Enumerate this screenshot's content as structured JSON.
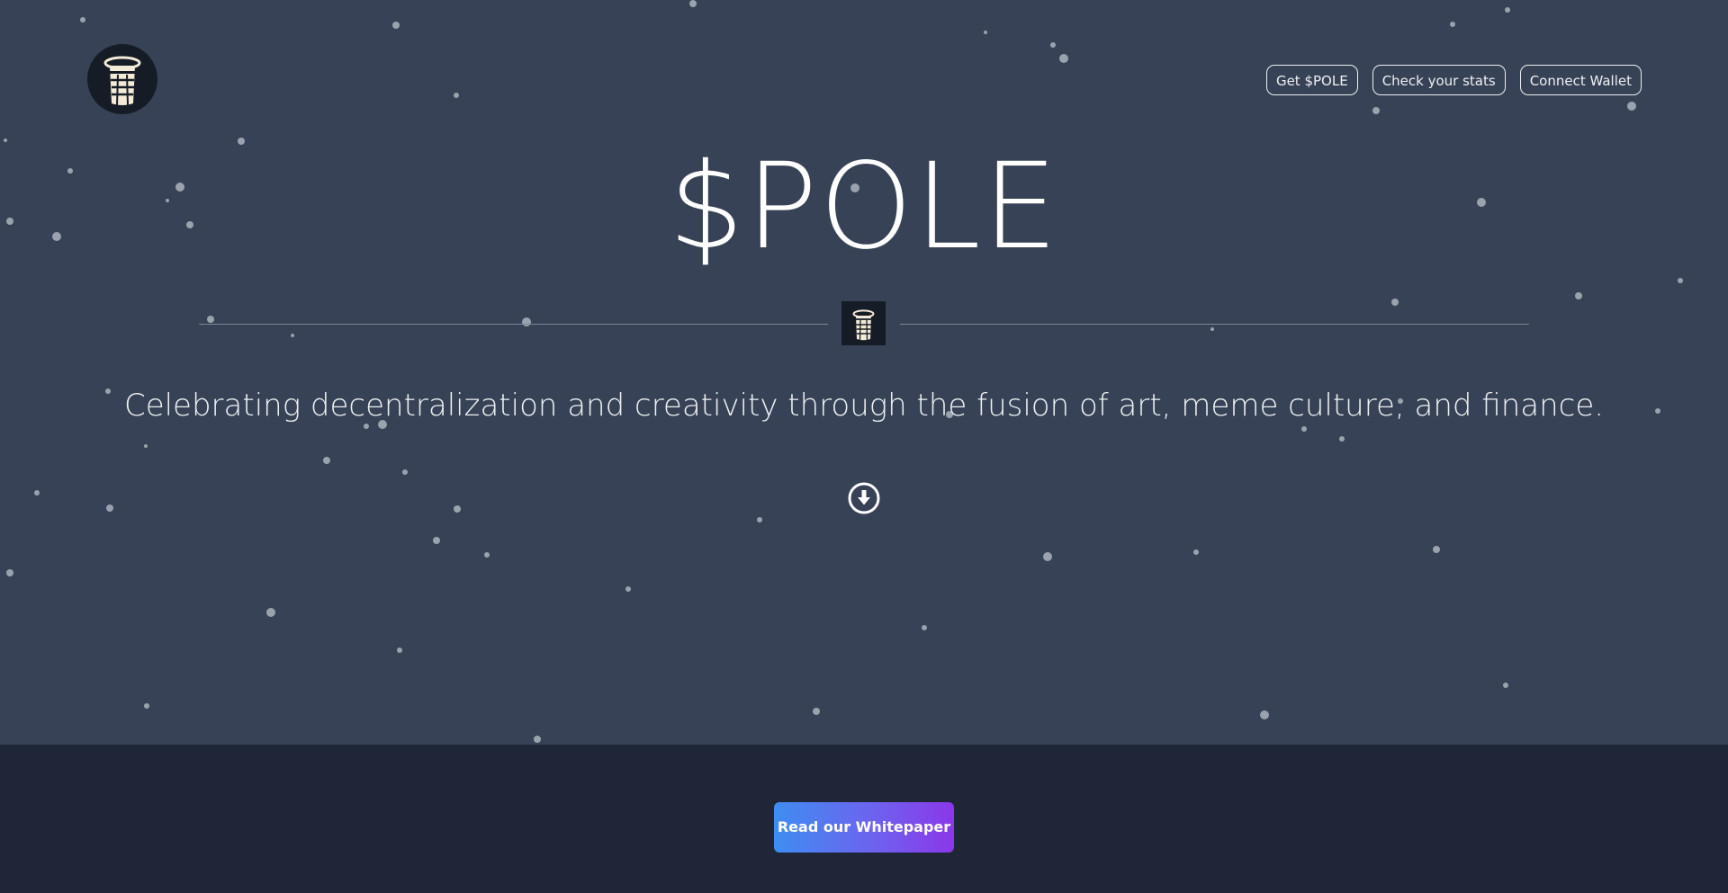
{
  "brand": {
    "logo_icon": "tower-logo-icon",
    "accent_gradient": [
      "#3f8df2",
      "#8b37ea"
    ],
    "hero_bg": "#374256",
    "footer_bg": "#1e2637"
  },
  "nav": {
    "items": [
      {
        "label": "Get $POLE"
      },
      {
        "label": "Check your stats"
      },
      {
        "label": "Connect Wallet"
      }
    ]
  },
  "hero": {
    "title": "$POLE",
    "tagline": "Celebrating decentralization and creativity through the fusion of art, meme culture, and finance.",
    "scroll_icon": "arrow-down-circle-icon"
  },
  "footer": {
    "cta_label": "Read our Whitepaper"
  }
}
